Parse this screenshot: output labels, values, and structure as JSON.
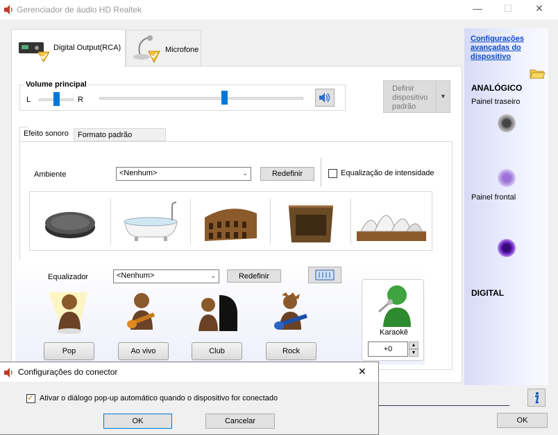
{
  "window": {
    "title": "Gerenciador de áudio HD Realtek",
    "minimize": "—",
    "maximize": "☐",
    "close": "✕"
  },
  "device_tabs": [
    {
      "label": "Digital Output(RCA)",
      "icon": "digital-output-icon"
    },
    {
      "label": "Microfone",
      "icon": "microphone-icon"
    }
  ],
  "volume": {
    "title": "Volume principal",
    "left_label": "L",
    "right_label": "R",
    "balance_level": 0.5,
    "volume_level": 0.6,
    "mute_icon": "speaker-icon",
    "set_default": "Definir dispositivo padrão"
  },
  "inner_tabs": [
    {
      "label": "Efeito sonoro"
    },
    {
      "label": "Formato padrão"
    }
  ],
  "environment": {
    "label": "Ambiente",
    "selected": "<Nenhum>",
    "reset": "Redefinir",
    "loudness_label": "Equalização de intensidade",
    "loudness_checked": false,
    "presets": [
      "stone-disc-icon",
      "bathtub-icon",
      "colosseum-icon",
      "wooden-room-icon",
      "opera-house-icon"
    ]
  },
  "equalizer": {
    "label": "Equalizador",
    "selected": "<Nenhum>",
    "reset": "Redefinir",
    "graphic_icon": "graphic-eq-icon",
    "presets": [
      "Pop",
      "Ao vivo",
      "Club",
      "Rock"
    ],
    "karaoke_label": "Karaokê",
    "karaoke_value": "+0"
  },
  "side": {
    "advanced_link": "Configurações avançadas do dispositivo",
    "analog_title": "ANALÓGICO",
    "rear_panel": "Painel traseiro",
    "front_panel": "Painel frontal",
    "digital_title": "DIGITAL",
    "ok": "OK",
    "info_icon": "info-icon",
    "colors": {
      "rear_jack": "#8a8a8a",
      "front_jack_1": "#b79ce6",
      "front_jack_2": "#7a2fd0"
    }
  },
  "dialog": {
    "title": "Configurações do conector",
    "checkbox_label": "Ativar o diálogo pop-up automático quando o dispositivo for conectado",
    "checked": true,
    "ok": "OK",
    "cancel": "Cancelar",
    "close": "✕"
  }
}
